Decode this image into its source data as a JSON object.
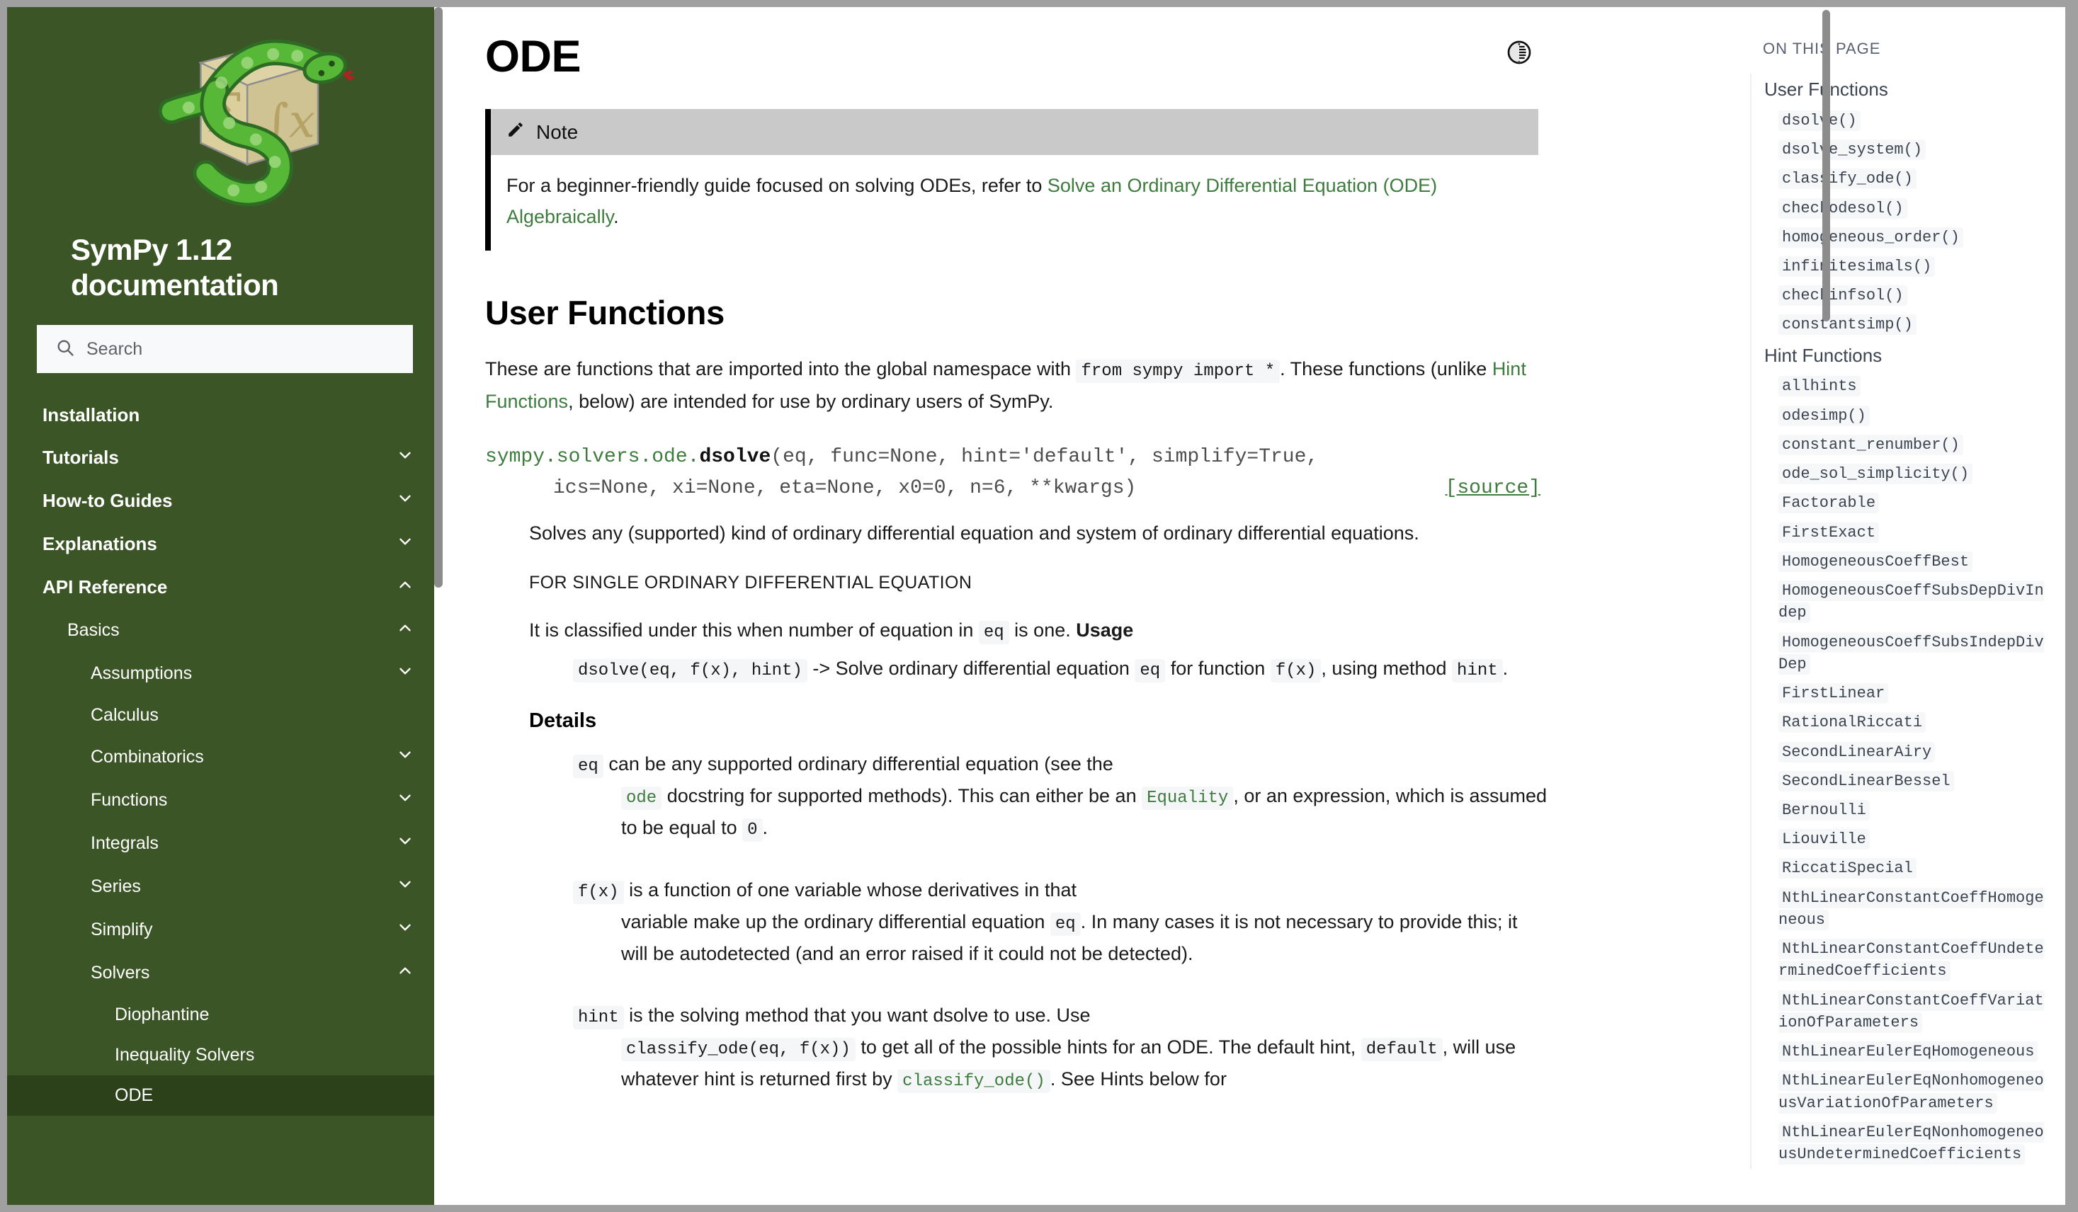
{
  "sidebar": {
    "brand_title": "SymPy 1.12 documentation",
    "logo_icon": "sympy-snake-cube-logo",
    "search": {
      "icon": "search-icon",
      "placeholder": "Search",
      "value": ""
    },
    "nav": [
      {
        "label": "Installation",
        "level": 1,
        "chevron": "none",
        "current": false
      },
      {
        "label": "Tutorials",
        "level": 1,
        "chevron": "down",
        "current": false
      },
      {
        "label": "How-to Guides",
        "level": 1,
        "chevron": "down",
        "current": false
      },
      {
        "label": "Explanations",
        "level": 1,
        "chevron": "down",
        "current": false
      },
      {
        "label": "API Reference",
        "level": 1,
        "chevron": "up",
        "current": false
      },
      {
        "label": "Basics",
        "level": 2,
        "chevron": "up",
        "current": false
      },
      {
        "label": "Assumptions",
        "level": 3,
        "chevron": "down",
        "current": false
      },
      {
        "label": "Calculus",
        "level": 3,
        "chevron": "none",
        "current": false
      },
      {
        "label": "Combinatorics",
        "level": 3,
        "chevron": "down",
        "current": false
      },
      {
        "label": "Functions",
        "level": 3,
        "chevron": "down",
        "current": false
      },
      {
        "label": "Integrals",
        "level": 3,
        "chevron": "down",
        "current": false
      },
      {
        "label": "Series",
        "level": 3,
        "chevron": "down",
        "current": false
      },
      {
        "label": "Simplify",
        "level": 3,
        "chevron": "down",
        "current": false
      },
      {
        "label": "Solvers",
        "level": 3,
        "chevron": "up",
        "current": false
      },
      {
        "label": "Diophantine",
        "level": 4,
        "chevron": "none",
        "current": false
      },
      {
        "label": "Inequality Solvers",
        "level": 4,
        "chevron": "none",
        "current": false
      },
      {
        "label": "ODE",
        "level": 4,
        "chevron": "none",
        "current": true
      }
    ]
  },
  "main": {
    "theme_toggle_icon": "theme-contrast-icon",
    "page_title": "ODE",
    "note": {
      "icon": "pencil-icon",
      "title": "Note",
      "text_before": "For a beginner-friendly guide focused on solving ODEs, refer to ",
      "link_text": "Solve an Ordinary Differential Equation (ODE) Algebraically",
      "text_after": "."
    },
    "section_title": "User Functions",
    "intro": {
      "part1": "These are functions that are imported into the global namespace with ",
      "code1": "from sympy import *",
      "part2": ". These functions (unlike ",
      "link1": "Hint Functions",
      "part3": ", below) are intended for use by ordinary users of SymPy."
    },
    "signature": {
      "module": "sympy.solvers.ode.",
      "name": "dsolve",
      "args_line1": "(eq, func=None, hint='default', simplify=True,",
      "args_line2": "ics=None, xi=None, eta=None, x0=0, n=6, **kwargs)",
      "source_label": "[source]"
    },
    "description": "Solves any (supported) kind of ordinary differential equation and system of ordinary differential equations.",
    "rubric": "FOR SINGLE ORDINARY DIFFERENTIAL EQUATION",
    "classified": {
      "part1": "It is classified under this when number of equation in ",
      "code_eq": "eq",
      "part2": " is one. ",
      "usage_label": "Usage"
    },
    "usage": {
      "code_call": "dsolve(eq, f(x), hint)",
      "part1": " -> Solve ordinary differential equation ",
      "code_eq": "eq",
      "part2": " for function ",
      "code_fx": "f(x)",
      "part3": ", using method ",
      "code_hint": "hint",
      "part4": "."
    },
    "details_label": "Details",
    "details": [
      {
        "term_code": "eq",
        "term_text": " can be any supported ordinary differential equation (see the",
        "def_parts": [
          {
            "type": "code_green",
            "text": "ode"
          },
          {
            "type": "text",
            "text": " docstring for supported methods). This can either be an "
          },
          {
            "type": "code_green",
            "text": "Equality"
          },
          {
            "type": "text",
            "text": ", or an expression, which is assumed to be equal to "
          },
          {
            "type": "code",
            "text": "0"
          },
          {
            "type": "text",
            "text": "."
          }
        ]
      },
      {
        "term_code": "f(x)",
        "term_text": " is a function of one variable whose derivatives in that",
        "def_parts": [
          {
            "type": "text",
            "text": "variable make up the ordinary differential equation "
          },
          {
            "type": "code",
            "text": "eq"
          },
          {
            "type": "text",
            "text": ". In many cases it is not necessary to provide this; it will be autodetected (and an error raised if it could not be detected)."
          }
        ]
      },
      {
        "term_code": "hint",
        "term_text": " is the solving method that you want dsolve to use. Use",
        "def_parts": [
          {
            "type": "code",
            "text": "classify_ode(eq, f(x))"
          },
          {
            "type": "text",
            "text": " to get all of the possible hints for an ODE. The default hint, "
          },
          {
            "type": "code",
            "text": "default"
          },
          {
            "type": "text",
            "text": ", will use whatever hint is returned first by "
          },
          {
            "type": "code_green",
            "text": "classify_ode()"
          },
          {
            "type": "text",
            "text": ". See Hints below for"
          }
        ]
      }
    ]
  },
  "toc": {
    "caption": "ON THIS PAGE",
    "items": [
      {
        "level": 2,
        "label": "User Functions",
        "style": "plain"
      },
      {
        "level": 3,
        "label": "dsolve()",
        "style": "code"
      },
      {
        "level": 3,
        "label": "dsolve_system()",
        "style": "code"
      },
      {
        "level": 3,
        "label": "classify_ode()",
        "style": "code"
      },
      {
        "level": 3,
        "label": "checkodesol()",
        "style": "code"
      },
      {
        "level": 3,
        "label": "homogeneous_order()",
        "style": "code"
      },
      {
        "level": 3,
        "label": "infinitesimals()",
        "style": "code"
      },
      {
        "level": 3,
        "label": "checkinfsol()",
        "style": "code"
      },
      {
        "level": 3,
        "label": "constantsimp()",
        "style": "code"
      },
      {
        "level": 2,
        "label": "Hint Functions",
        "style": "plain"
      },
      {
        "level": 3,
        "label": "allhints",
        "style": "code"
      },
      {
        "level": 3,
        "label": "odesimp()",
        "style": "code"
      },
      {
        "level": 3,
        "label": "constant_renumber()",
        "style": "code"
      },
      {
        "level": 3,
        "label": "ode_sol_simplicity()",
        "style": "code"
      },
      {
        "level": 3,
        "label": "Factorable",
        "style": "code"
      },
      {
        "level": 3,
        "label": "FirstExact",
        "style": "code"
      },
      {
        "level": 3,
        "label": "HomogeneousCoeffBest",
        "style": "code"
      },
      {
        "level": 3,
        "label": "HomogeneousCoeffSubsDepDivIndep",
        "style": "code"
      },
      {
        "level": 3,
        "label": "HomogeneousCoeffSubsIndepDivDep",
        "style": "code"
      },
      {
        "level": 3,
        "label": "FirstLinear",
        "style": "code"
      },
      {
        "level": 3,
        "label": "RationalRiccati",
        "style": "code"
      },
      {
        "level": 3,
        "label": "SecondLinearAiry",
        "style": "code"
      },
      {
        "level": 3,
        "label": "SecondLinearBessel",
        "style": "code"
      },
      {
        "level": 3,
        "label": "Bernoulli",
        "style": "code"
      },
      {
        "level": 3,
        "label": "Liouville",
        "style": "code"
      },
      {
        "level": 3,
        "label": "RiccatiSpecial",
        "style": "code"
      },
      {
        "level": 3,
        "label": "NthLinearConstantCoeffHomogeneous",
        "style": "code"
      },
      {
        "level": 3,
        "label": "NthLinearConstantCoeffUndeterminedCoefficients",
        "style": "code"
      },
      {
        "level": 3,
        "label": "NthLinearConstantCoeffVariationOfParameters",
        "style": "code"
      },
      {
        "level": 3,
        "label": "NthLinearEulerEqHomogeneous",
        "style": "code"
      },
      {
        "level": 3,
        "label": "NthLinearEulerEqNonhomogeneousVariationOfParameters",
        "style": "code"
      },
      {
        "level": 3,
        "label": "NthLinearEulerEqNonhomogeneousUndeterminedCoefficients",
        "style": "code"
      }
    ]
  },
  "colors": {
    "sidebar_bg": "#3b5526",
    "sidebar_active": "#2c4019",
    "link_green": "#3e7c3e",
    "note_header": "#c9c9c9",
    "frame": "#a0a0a0"
  }
}
